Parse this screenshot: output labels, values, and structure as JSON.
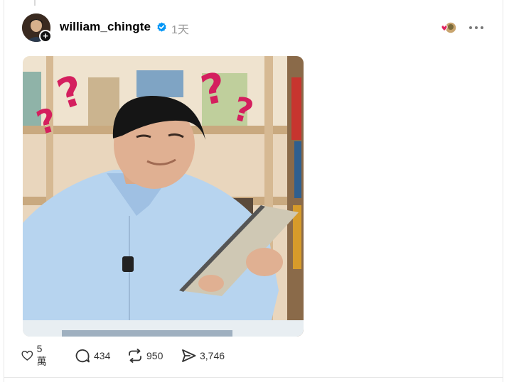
{
  "post": {
    "username": "william_chingte",
    "timestamp": "1天",
    "image": {
      "question_mark": "?"
    },
    "actions": {
      "like_count": "5 萬",
      "reply_count": "434",
      "repost_count": "950",
      "share_count": "3,746"
    }
  },
  "icons": {
    "like": "heart-icon",
    "reply": "speech-bubble-icon",
    "repost": "repost-arrows-icon",
    "share": "paper-plane-icon",
    "more": "ellipsis-icon",
    "verified": "verified-badge-icon",
    "follow": "plus-icon"
  },
  "colors": {
    "verified_blue": "#0095f6",
    "question_mark_magenta": "#d41f5e",
    "shirt_blue": "#b7d4ef",
    "text_secondary": "#999999"
  }
}
